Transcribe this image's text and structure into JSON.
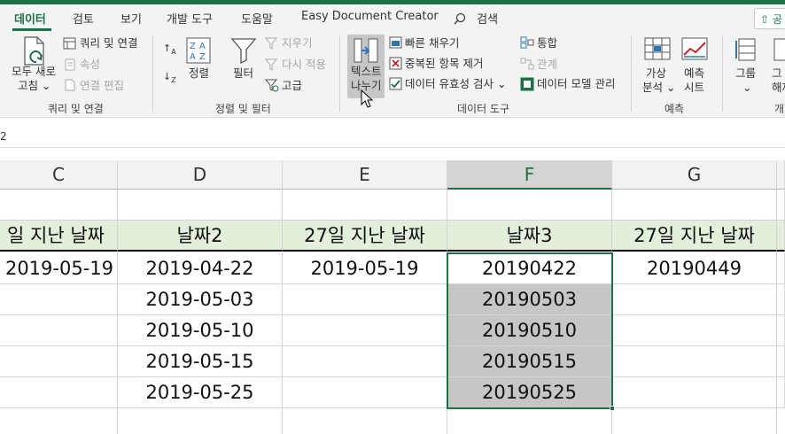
{
  "tabs": [
    "데이터",
    "검토",
    "보기",
    "개발 도구",
    "도움말",
    "Easy Document Creator"
  ],
  "search_label": "검색",
  "share_label": "공",
  "ribbon": {
    "queries": {
      "refresh_all": [
        "모두 새로",
        "고침"
      ],
      "queries_connections": "쿼리 및 연결",
      "properties": "속성",
      "edit_links": "연결 편집",
      "group_label": "쿼리 및 연결"
    },
    "sort_filter": {
      "sort": "정렬",
      "filter": "필터",
      "clear": "지우기",
      "reapply": "다시 적용",
      "advanced": "고급",
      "group_label": "정렬 및 필터"
    },
    "data_tools": {
      "text_to_columns": [
        "텍스트",
        "나누기"
      ],
      "flash_fill": "빠른 채우기",
      "remove_duplicates": "중복된 항목 제거",
      "data_validation": "데이터 유효성 검사",
      "consolidate": "통합",
      "relationships": "관계",
      "data_model": "데이터 모델 관리",
      "group_label": "데이터 도구"
    },
    "forecast": {
      "what_if": [
        "가상",
        "분석"
      ],
      "forecast_sheet": [
        "예측",
        "시트"
      ],
      "group_label": "예측"
    },
    "outline": {
      "group": "그룹",
      "ungroup": [
        "그",
        "해제"
      ],
      "group_label": "개"
    }
  },
  "name_box": "2",
  "columns": [
    "C",
    "D",
    "E",
    "F",
    "G"
  ],
  "header_row": [
    "일 지난 날짜",
    "날짜2",
    "27일 지난 날짜",
    "날짜3",
    "27일 지난 날짜"
  ],
  "rows": [
    [
      "2019-05-19",
      "2019-04-22",
      "2019-05-19",
      "20190422",
      "20190449"
    ],
    [
      "",
      "2019-05-03",
      "",
      "20190503",
      ""
    ],
    [
      "",
      "2019-05-10",
      "",
      "20190510",
      ""
    ],
    [
      "",
      "2019-05-15",
      "",
      "20190515",
      ""
    ],
    [
      "",
      "2019-05-25",
      "",
      "20190525",
      ""
    ]
  ],
  "colors": {
    "accent": "#1e7145",
    "header_fill": "#e2efda",
    "selection_fill": "#c6c6c6"
  }
}
